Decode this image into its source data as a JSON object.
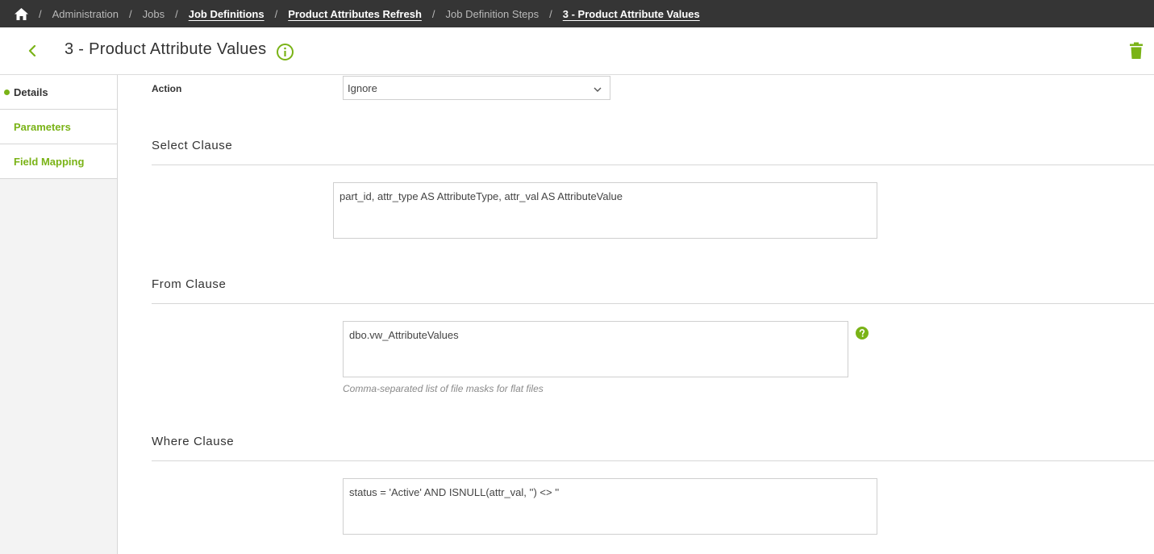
{
  "breadcrumb": {
    "items": [
      "Administration",
      "Jobs",
      "Job Definitions",
      "Product Attributes Refresh",
      "Job Definition Steps",
      "3 - Product Attribute Values"
    ],
    "separator": "/"
  },
  "header": {
    "title": "3 - Product Attribute Values"
  },
  "sidebar": {
    "items": [
      {
        "label": "Details"
      },
      {
        "label": "Parameters"
      },
      {
        "label": "Field Mapping"
      }
    ]
  },
  "action": {
    "label": "Action",
    "selected": "Ignore"
  },
  "select_clause": {
    "title": "Select Clause",
    "value": "part_id, attr_type AS AttributeType, attr_val AS AttributeValue"
  },
  "from_clause": {
    "title": "From Clause",
    "value": "dbo.vw_AttributeValues",
    "hint": "Comma-separated list of file masks for flat files"
  },
  "where_clause": {
    "title": "Where Clause",
    "value": "status = 'Active' AND ISNULL(attr_val, '') <> ''"
  },
  "colors": {
    "accent": "#7ab317",
    "topbar": "#353535"
  },
  "icons": {
    "home": "home-icon",
    "back": "chevron-left-icon",
    "info": "info-icon",
    "trash": "trash-icon",
    "dropdown": "chevron-down-icon",
    "help": "help-icon"
  }
}
